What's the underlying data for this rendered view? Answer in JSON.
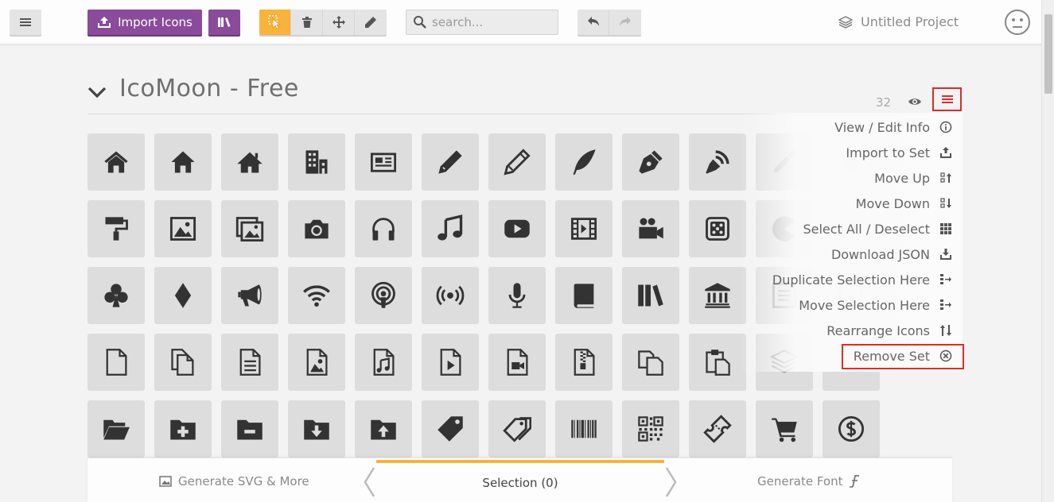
{
  "toolbar": {
    "import_label": "Import Icons",
    "search_placeholder": "search...",
    "project_name": "Untitled Project"
  },
  "set": {
    "title": "IcoMoon - Free",
    "count": "32"
  },
  "set_menu": {
    "items": [
      {
        "label": "View / Edit Info",
        "icon": "info-icon"
      },
      {
        "label": "Import to Set",
        "icon": "import-icon"
      },
      {
        "label": "Move Up",
        "icon": "move-up-icon"
      },
      {
        "label": "Move Down",
        "icon": "move-down-icon"
      },
      {
        "label": "Select All / Deselect",
        "icon": "grid-icon"
      },
      {
        "label": "Download JSON",
        "icon": "download-icon"
      },
      {
        "label": "Duplicate Selection Here",
        "icon": "duplicate-icon"
      },
      {
        "label": "Move Selection Here",
        "icon": "move-selection-icon"
      },
      {
        "label": "Rearrange Icons",
        "icon": "sort-icon"
      },
      {
        "label": "Remove Set",
        "icon": "remove-circle-icon"
      }
    ]
  },
  "bottom": {
    "generate_svg": "Generate SVG & More",
    "selection": "Selection (0)",
    "generate_font": "Generate Font"
  },
  "colors": {
    "accent_purple": "#8a4b9a",
    "accent_orange": "#f7b33c",
    "highlight_red": "#e02a2a",
    "icon_dark": "#333333"
  },
  "icons": [
    [
      "home-icon",
      "home2-icon",
      "home3-icon",
      "office-icon",
      "newspaper-icon",
      "pencil-icon",
      "pencil2-icon",
      "quill-icon",
      "pen-icon",
      "blog-icon",
      "eyedropper-icon",
      "droplet-icon"
    ],
    [
      "paint-format-icon",
      "image-icon",
      "images-icon",
      "camera-icon",
      "headphones-icon",
      "music-icon",
      "play-icon",
      "film-icon",
      "video-camera-icon",
      "dice-icon",
      "pacman-icon",
      "spades-icon"
    ],
    [
      "clubs-icon",
      "diamonds-icon",
      "bullhorn-icon",
      "connection-icon",
      "podcast-icon",
      "feed-icon",
      "mic-icon",
      "book-icon",
      "books-icon",
      "library-icon",
      "file-text-icon",
      "profile-icon"
    ],
    [
      "file-empty-icon",
      "files-empty-icon",
      "file-text2-icon",
      "file-picture-icon",
      "file-music-icon",
      "file-play-icon",
      "file-video-icon",
      "file-zip-icon",
      "copy-icon",
      "paste-icon",
      "stack-icon",
      "folder-icon"
    ],
    [
      "folder-open-icon",
      "folder-plus-icon",
      "folder-minus-icon",
      "folder-download-icon",
      "folder-upload-icon",
      "price-tag-icon",
      "price-tags-icon",
      "barcode-icon",
      "qrcode-icon",
      "ticket-icon",
      "cart-icon",
      "coin-dollar-icon"
    ]
  ]
}
